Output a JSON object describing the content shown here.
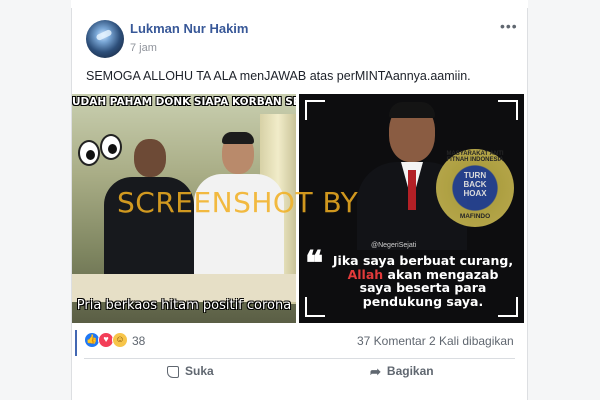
{
  "post": {
    "author": "Lukman Nur Hakim",
    "time": "7 jam",
    "more_icon": "•••",
    "text": "SEMOGA ALLOHU TA ALA menJAWAB atas perMINTAannya.aamiin."
  },
  "image_left": {
    "caption_top": "UDAH PAHAM DONK SIAPA KORBAN SELANJUTNYA",
    "caption_bottom": "Pria berkaos hitam positif corona"
  },
  "image_right": {
    "handle": "@NegeriSejati",
    "quote_line1": "Jika saya berbuat curang,",
    "quote_allah": "Allah",
    "quote_line2_rest": " akan mengazab",
    "quote_line3": "saya beserta para",
    "quote_line4": "pendukung saya.",
    "stamp_top": "MASYARAKAT ANTI FITNAH INDONESIA",
    "stamp_center": "TURN BACK HOAX",
    "stamp_bottom": "MAFINDO"
  },
  "watermark": "SCREENSHOT BY",
  "reactions": {
    "count": "38",
    "comments": "37 Komentar",
    "shares": "2 Kali dibagikan"
  },
  "actions": {
    "like": "Suka",
    "share": "Bagikan"
  },
  "colors": {
    "name_link": "#385898",
    "meta_gray": "#90949c",
    "watermark": "#f2b021"
  }
}
